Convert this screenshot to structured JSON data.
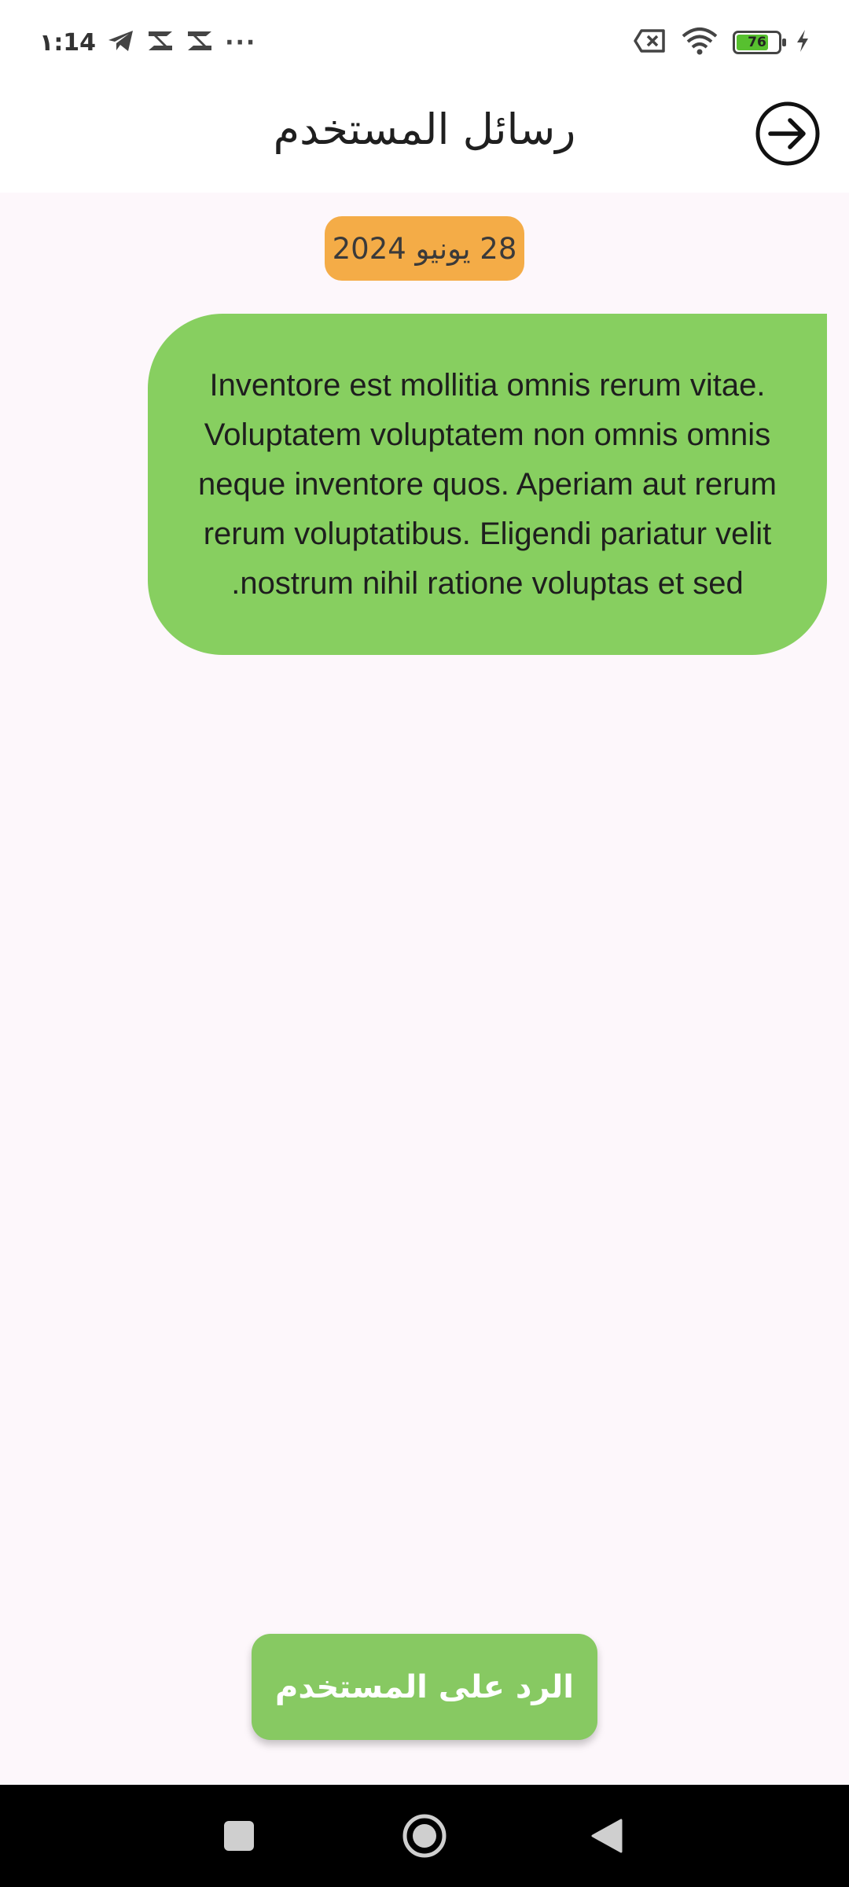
{
  "status_bar": {
    "time": "١:14",
    "more_indicator": "···",
    "battery_level": "76",
    "battery_fraction": 0.76,
    "icons": [
      "telegram-icon",
      "capcut-icon",
      "capcut-icon",
      "sim-no-service-icon",
      "wifi-icon",
      "battery-icon",
      "charging-icon"
    ]
  },
  "header": {
    "title": "رسائل المستخدم",
    "back_icon": "arrow-right-circle-icon"
  },
  "chat": {
    "date_label": "28 يونيو 2024",
    "message_text": "Inventore est mollitia omnis rerum vitae. Voluptatem voluptatem non omnis omnis neque inventore quos. Aperiam aut rerum rerum voluptatibus. Eligendi pariatur velit nostrum nihil ratione voluptas et sed.",
    "bubble_color": "#87cf60",
    "date_badge_color": "#f4ac47"
  },
  "actions": {
    "reply_label": "الرد على المستخدم",
    "reply_color": "#87c962"
  },
  "nav_bar": {
    "icons": [
      "recents-square-icon",
      "home-circle-icon",
      "back-triangle-icon"
    ]
  }
}
